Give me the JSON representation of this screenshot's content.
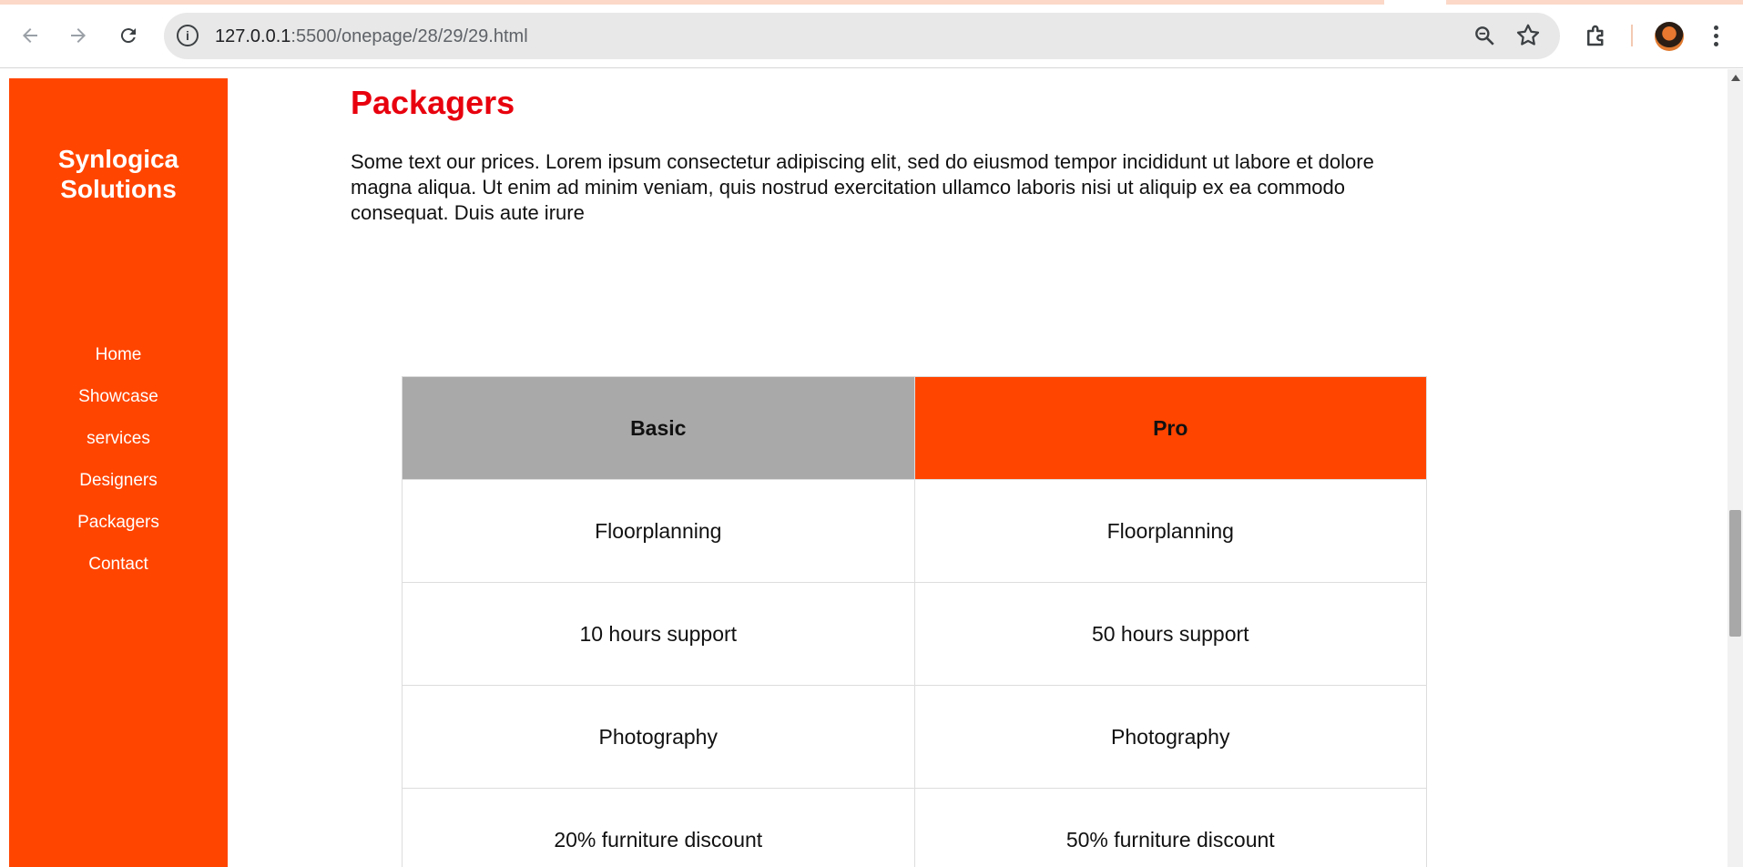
{
  "browser": {
    "url_host": "127.0.0.1",
    "url_path": ":5500/onepage/28/29/29.html",
    "icons": [
      "back-arrow-icon",
      "forward-arrow-icon",
      "reload-icon",
      "info-icon",
      "zoom-icon",
      "star-icon",
      "extensions-icon",
      "avatar",
      "menu-dots-icon"
    ]
  },
  "sidebar": {
    "brand_line1": "Synlogica",
    "brand_line2": "Solutions",
    "items": [
      {
        "label": "Home"
      },
      {
        "label": "Showcase"
      },
      {
        "label": "services"
      },
      {
        "label": "Designers"
      },
      {
        "label": "Packagers"
      },
      {
        "label": "Contact"
      }
    ]
  },
  "main": {
    "heading": "Packagers",
    "paragraph": "Some text our prices. Lorem ipsum consectetur adipiscing elit, sed do eiusmod tempor incididunt ut labore et dolore magna aliqua. Ut enim ad minim veniam, quis nostrud exercitation ullamco laboris nisi ut aliquip ex ea commodo consequat. Duis aute irure"
  },
  "pricing": {
    "headers": [
      "Basic",
      "Pro"
    ],
    "rows": [
      [
        "Floorplanning",
        "Floorplanning"
      ],
      [
        "10 hours support",
        "50 hours support"
      ],
      [
        "Photography",
        "Photography"
      ],
      [
        "20% furniture discount",
        "50% furniture discount"
      ]
    ]
  },
  "colors": {
    "accent": "#ff4500",
    "heading": "#e8000e",
    "basic_header": "#a9a9a9"
  }
}
